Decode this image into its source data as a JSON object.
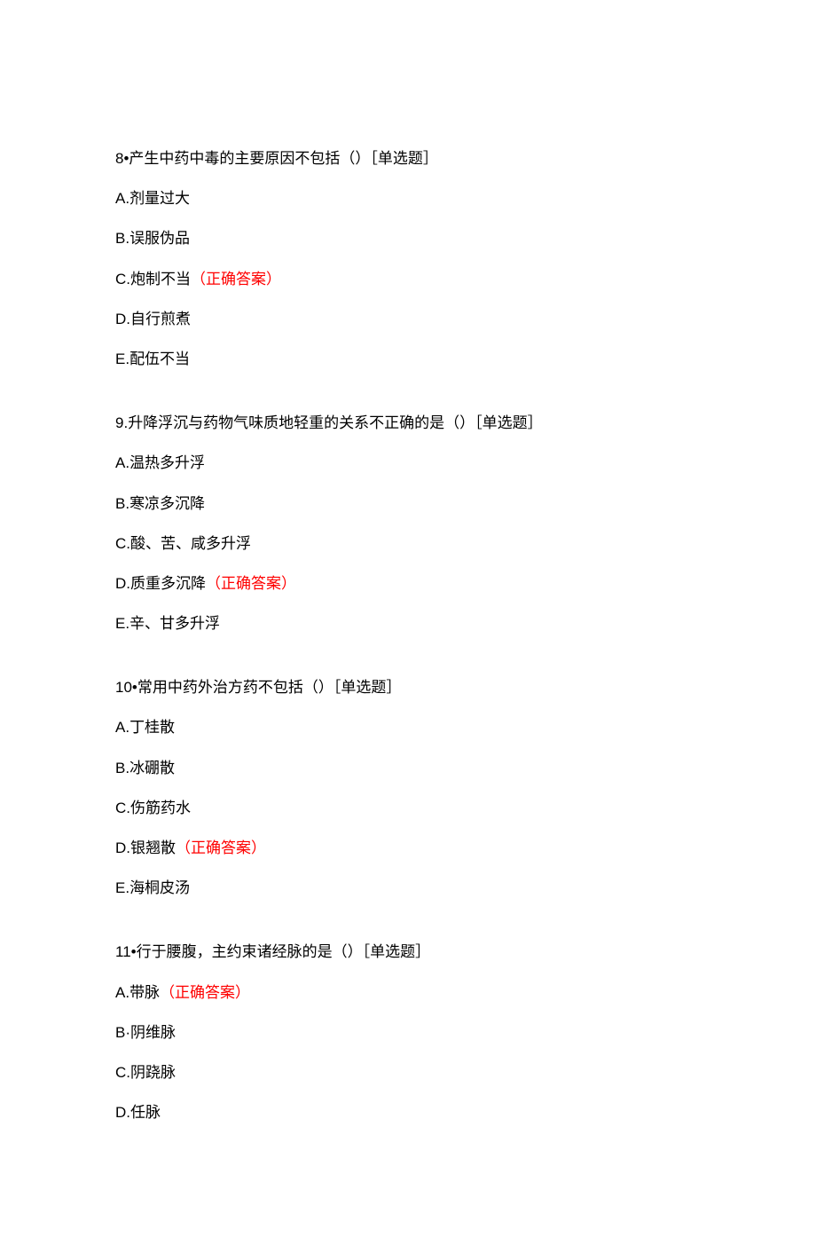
{
  "questions": [
    {
      "number": "8•",
      "stem": "产生中药中毒的主要原因不包括（）",
      "type": "［单选题］",
      "options": [
        {
          "letter": "A.",
          "text": "剂量过大",
          "correct": false
        },
        {
          "letter": "B.",
          "text": "误服伪品",
          "correct": false
        },
        {
          "letter": "C.",
          "text": "炮制不当",
          "correct": true
        },
        {
          "letter": "D.",
          "text": "自行煎煮",
          "correct": false
        },
        {
          "letter": "E.",
          "text": "配伍不当",
          "correct": false
        }
      ],
      "correct_label": "（正确答案）"
    },
    {
      "number": "9.",
      "stem": "升降浮沉与药物气味质地轻重的关系不正确的是（）",
      "type": "［单选题］",
      "options": [
        {
          "letter": "A.",
          "text": "温热多升浮",
          "correct": false
        },
        {
          "letter": "B.",
          "text": "寒凉多沉降",
          "correct": false
        },
        {
          "letter": "C.",
          "text": "酸、苦、咸多升浮",
          "correct": false
        },
        {
          "letter": "D.",
          "text": "质重多沉降",
          "correct": true
        },
        {
          "letter": "E.",
          "text": "辛、甘多升浮",
          "correct": false
        }
      ],
      "correct_label": "（正确答案）"
    },
    {
      "number": "10•",
      "stem": "常用中药外治方药不包括（）",
      "type": "［单选题］",
      "options": [
        {
          "letter": "A.",
          "text": "丁桂散",
          "correct": false
        },
        {
          "letter": "B.",
          "text": "冰硼散",
          "correct": false
        },
        {
          "letter": "C.",
          "text": "伤筋药水",
          "correct": false
        },
        {
          "letter": "D.",
          "text": "银翘散",
          "correct": true
        },
        {
          "letter": "E.",
          "text": "海桐皮汤",
          "correct": false
        }
      ],
      "correct_label": "（正确答案）"
    },
    {
      "number": "11•",
      "stem": "行于腰腹，主约束诸经脉的是（）",
      "type": "［单选题］",
      "options": [
        {
          "letter": "A.",
          "text": "带脉",
          "correct": true
        },
        {
          "letter": "B·",
          "text": "阴维脉",
          "correct": false
        },
        {
          "letter": "C.",
          "text": "阴跷脉",
          "correct": false
        },
        {
          "letter": "D.",
          "text": "任脉",
          "correct": false
        }
      ],
      "correct_label": "（正确答案）"
    }
  ]
}
